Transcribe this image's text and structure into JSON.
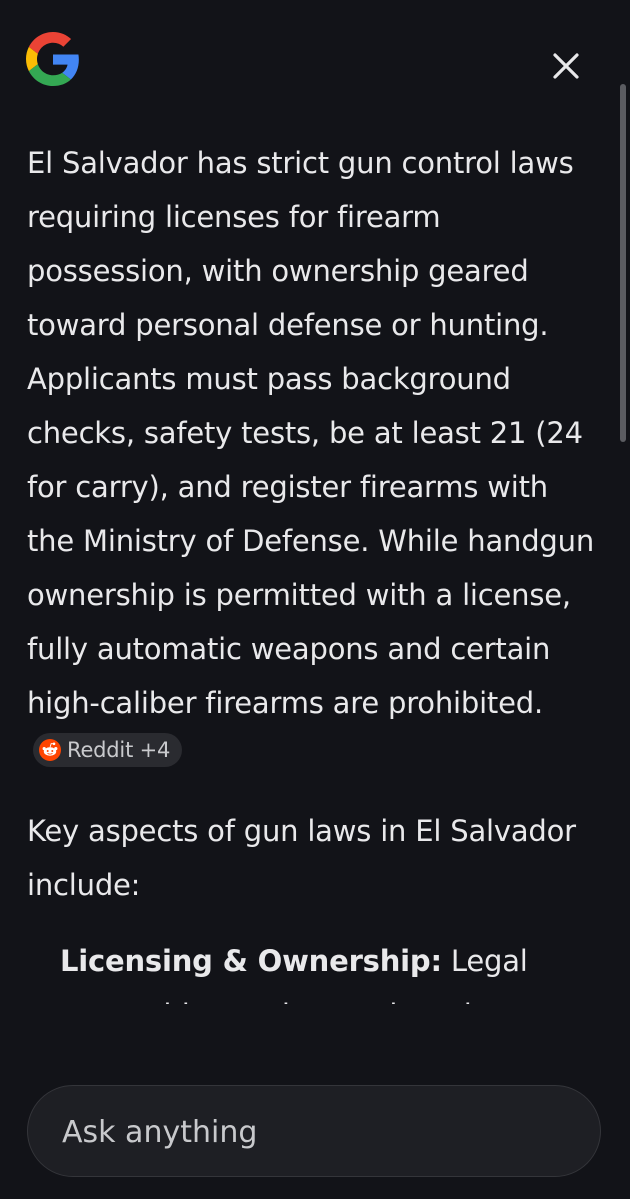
{
  "header": {
    "logo_icon": "google-g-icon",
    "close_icon": "close-icon"
  },
  "answer": {
    "paragraph1": "El Salvador has strict gun control laws requiring licenses for firearm possession, with ownership geared toward personal defense or hunting. Applicants must pass background checks, safety tests, be at least 21 (24 for carry), and register firearms with the Ministry of Defense. While handgun ownership is permitted with a license, fully automatic weapons and certain high-caliber firearms are prohibited.",
    "source_chip": {
      "icon": "reddit-icon",
      "label": "Reddit +4"
    },
    "paragraph2": "Key aspects of gun laws in El Salvador include:",
    "bullets": [
      {
        "title": "Licensing & Ownership:",
        "text": " Legal ownership requires registration"
      }
    ]
  },
  "composer": {
    "placeholder": "Ask anything"
  },
  "colors": {
    "background": "#121318",
    "text": "#e9e9eb",
    "chip_background": "#2a2b30",
    "reddit_orange": "#ff4500"
  }
}
